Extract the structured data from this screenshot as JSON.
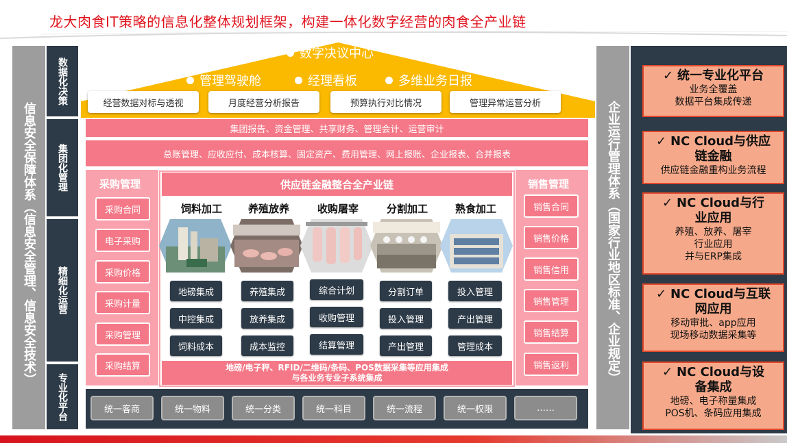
{
  "title": "龙大肉食IT策略的信息化整体规划框架，构建一体化数字经营的肉食全产业链",
  "left_bar": "信息安全保障体系（信息安全管理、信息安全技术）",
  "right_bar": "企业运行管理体系（国家行业地区标准、企业规定）",
  "layers": [
    "数据化决策",
    "集团化管理",
    "精细化运营",
    "专业化平台"
  ],
  "decision": {
    "center": "数字决议中心",
    "items": [
      "管理驾驶舱",
      "经理看板",
      "多维业务日报"
    ],
    "reports": [
      "经营数据对标与透视",
      "月度经营分析报告",
      "预算执行对比情况",
      "管理异常运营分析"
    ]
  },
  "group_mgmt": {
    "row1": "集团报告、资金管理、共享财务、管理会计、运营审计",
    "row2": "总账管理、应收应付、成本核算、固定资产、费用管理、网上报账、企业报表、合并报表"
  },
  "purchase": {
    "title": "采购管理",
    "items": [
      "采购合同",
      "电子采购",
      "采购价格",
      "采购计量",
      "采购管理",
      "采购结算"
    ]
  },
  "sales": {
    "title": "销售管理",
    "items": [
      "销售合同",
      "销售价格",
      "销售信用",
      "销售管理",
      "销售结算",
      "销售返利"
    ]
  },
  "chain": {
    "title": "供应链金融整合全产业链",
    "stages": [
      {
        "name": "饲料加工",
        "items": [
          "地磅集成",
          "中控集成",
          "饲料成本"
        ]
      },
      {
        "name": "养殖放养",
        "items": [
          "养殖集成",
          "放养集成",
          "成本监控"
        ]
      },
      {
        "name": "收购屠宰",
        "items": [
          "综合计划",
          "收购管理",
          "结算管理"
        ]
      },
      {
        "name": "分割加工",
        "items": [
          "分割订单",
          "投入管理",
          "产出管理"
        ]
      },
      {
        "name": "熟食加工",
        "items": [
          "投入管理",
          "产出管理",
          "管理成本"
        ]
      }
    ],
    "bottom_line1": "地磅/电子秤、RFID/二维码/条码、POS数据采集等应用集成",
    "bottom_line2": "与各业务专业子系统集成"
  },
  "platform": [
    "统一客商",
    "统一物料",
    "统一分类",
    "统一科目",
    "统一流程",
    "统一权限",
    "……"
  ],
  "features": [
    {
      "title": [
        "统一专业化平台"
      ],
      "lines": [
        "业务全覆盖",
        "数据平台集成传递"
      ]
    },
    {
      "title": [
        "NC Cloud与供应",
        "链金融"
      ],
      "lines": [
        "供应链金融重构业务流程"
      ]
    },
    {
      "title": [
        "NC Cloud与行",
        "业应用"
      ],
      "lines": [
        "养殖、放养、屠宰",
        "行业应用",
        "并与ERP集成"
      ]
    },
    {
      "title": [
        "NC Cloud与互联",
        "网应用"
      ],
      "lines": [
        "移动审批、app应用",
        "现场移动数据采集等"
      ]
    },
    {
      "title": [
        "NC Cloud与设",
        "备集成"
      ],
      "lines": [
        "地磅、电子称量集成",
        "POS机、条码应用集成"
      ]
    }
  ],
  "check_mark": "✓",
  "colors": {
    "red": "#e0141e",
    "yellow": "#fbb900",
    "pink": "#f47887",
    "navy": "#2d3a47",
    "gray": "#9d9d9d",
    "orange": "#f6a98a"
  }
}
